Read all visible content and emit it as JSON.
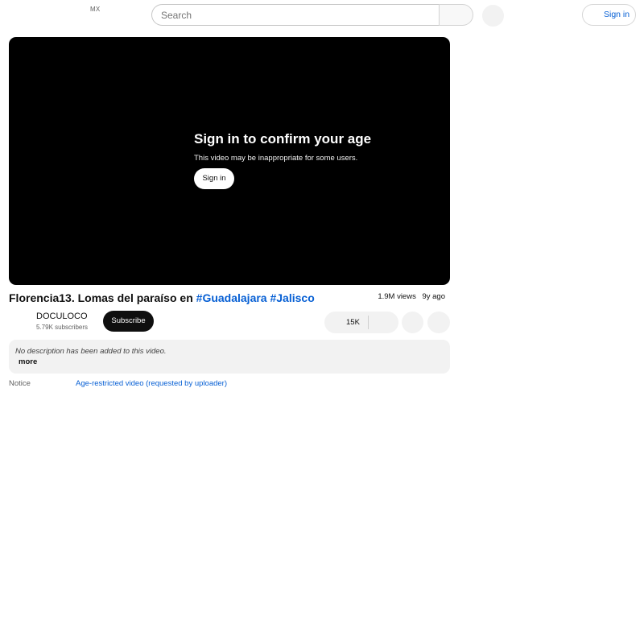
{
  "header": {
    "country_code": "MX",
    "search_placeholder": "Search",
    "sign_in_label": "Sign in"
  },
  "player": {
    "title": "Sign in to confirm your age",
    "subtitle": "This video may be inappropriate for some users.",
    "sign_in_label": "Sign in"
  },
  "video": {
    "title_prefix": "Florencia13. Lomas del paraíso en",
    "hashtags": [
      "#Guadalajara",
      "#Jalisco"
    ],
    "views": "1.9M views",
    "age": "9y ago"
  },
  "channel": {
    "name": "DOCULOCO",
    "subscribers": "5.79K subscribers",
    "subscribe_label": "Subscribe"
  },
  "actions": {
    "like_count": "15K"
  },
  "description": {
    "text": "No description has been added to this video.",
    "more_label": "more"
  },
  "notice": {
    "label": "Notice",
    "link_text": "Age-restricted video (requested by uploader)"
  },
  "colors": {
    "link": "#065fd4",
    "player_bg": "#000000",
    "chip_bg": "#f2f2f2"
  }
}
